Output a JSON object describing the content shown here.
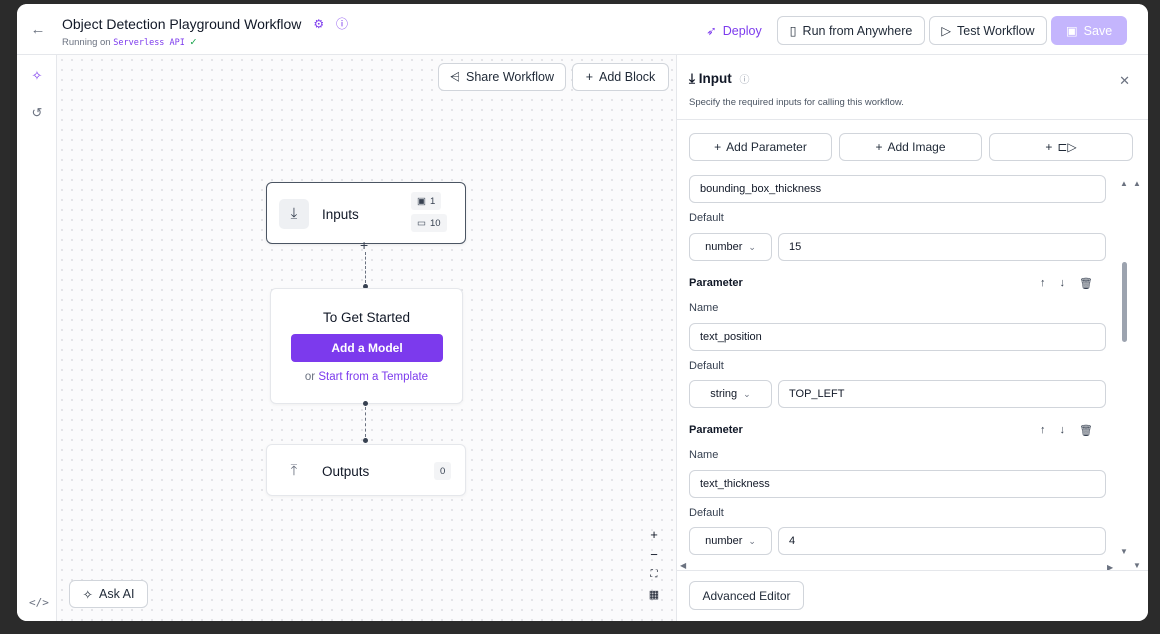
{
  "header": {
    "title": "Object Detection Playground Workflow",
    "subtitle_prefix": "Running on",
    "subtitle_mono": "Serverless API",
    "check": "✓"
  },
  "toolbar": {
    "deploy": "Deploy",
    "run_anywhere": "Run from Anywhere",
    "test_workflow": "Test Workflow",
    "save": "Save"
  },
  "canvas": {
    "share": "Share Workflow",
    "add_block": "Add Block",
    "ask_ai": "Ask AI",
    "inputs_node": {
      "label": "Inputs",
      "image_count": "1",
      "param_count": "10"
    },
    "start_node": {
      "title": "To Get Started",
      "add_model": "Add a Model",
      "or": "or",
      "template_link": "Start from a Template"
    },
    "outputs_node": {
      "label": "Outputs",
      "count": "0"
    }
  },
  "panel": {
    "title": "Input",
    "description": "Specify the required inputs for calling this workflow.",
    "add_parameter": "Add Parameter",
    "add_image": "Add Image",
    "plus": "+",
    "partial_field": "bounding_box_thickness",
    "default_label": "Default",
    "parameter_label": "Parameter",
    "name_label": "Name",
    "params": [
      {
        "type": "number",
        "default": "15"
      },
      {
        "name": "text_position",
        "type": "string",
        "default": "TOP_LEFT"
      },
      {
        "name": "text_thickness",
        "type": "number",
        "default": "4"
      }
    ],
    "advanced_editor": "Advanced Editor"
  },
  "colors": {
    "accent": "#7c3aed",
    "accent_light": "#c4b5fd",
    "border": "#d1d5db"
  }
}
